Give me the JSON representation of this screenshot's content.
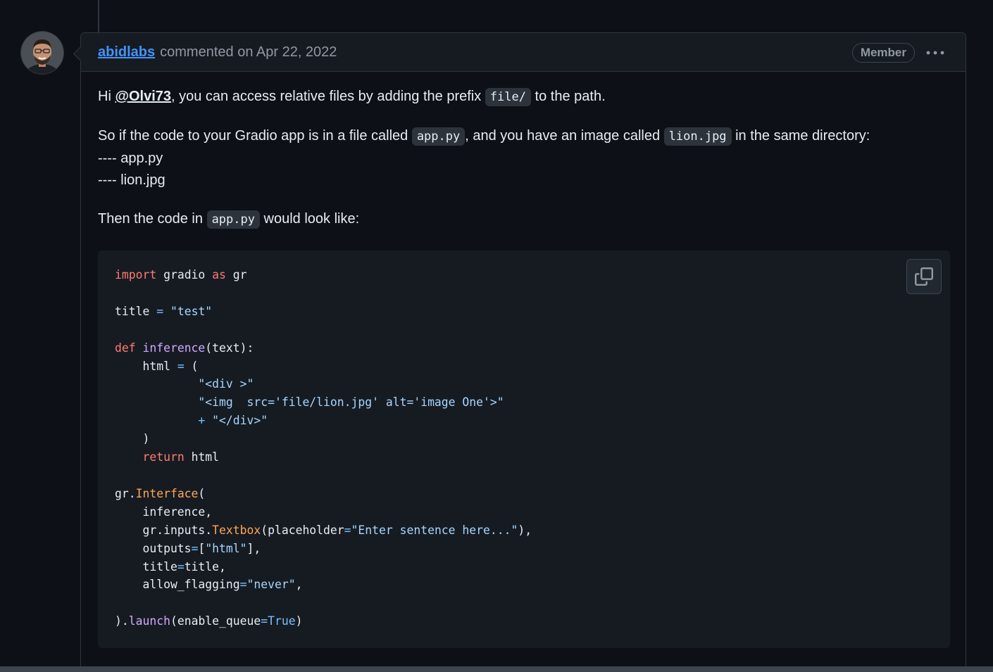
{
  "comment": {
    "author": "abidlabs",
    "action_text": "commented on Apr 22, 2022",
    "badge": "Member",
    "menu_icon": "kebab-horizontal-icon",
    "paragraph1": {
      "prefix": "Hi ",
      "mention": "@Olvi73",
      "middle": ", you can access relative files by adding the prefix ",
      "code": "file/",
      "suffix": " to the path."
    },
    "paragraph2": {
      "prefix": "So if the code to your Gradio app is in a file called ",
      "code1": "app.py",
      "middle": ", and you have an image called ",
      "code2": "lion.jpg",
      "suffix": " in the same directory:",
      "line1": "---- app.py",
      "line2": "---- lion.jpg"
    },
    "paragraph3": {
      "prefix": "Then the code in ",
      "code": "app.py",
      "suffix": " would look like:"
    },
    "code_block": {
      "copy_icon": "copy-icon",
      "lines": [
        [
          [
            "kw",
            "import"
          ],
          [
            "t",
            " gradio "
          ],
          [
            "kw",
            "as"
          ],
          [
            "t",
            " gr"
          ]
        ],
        [],
        [
          [
            "t",
            "title "
          ],
          [
            "op",
            "="
          ],
          [
            "t",
            " "
          ],
          [
            "str",
            "\"test\""
          ]
        ],
        [],
        [
          [
            "kw",
            "def"
          ],
          [
            "t",
            " "
          ],
          [
            "fn",
            "inference"
          ],
          [
            "t",
            "(text):"
          ]
        ],
        [
          [
            "t",
            "    html "
          ],
          [
            "op",
            "="
          ],
          [
            "t",
            " ("
          ]
        ],
        [
          [
            "t",
            "            "
          ],
          [
            "str",
            "\"<div >\""
          ]
        ],
        [
          [
            "t",
            "            "
          ],
          [
            "str",
            "\"<img  src='file/lion.jpg' alt='image One'>\""
          ]
        ],
        [
          [
            "t",
            "            "
          ],
          [
            "op",
            "+"
          ],
          [
            "t",
            " "
          ],
          [
            "str",
            "\"</div>\""
          ]
        ],
        [
          [
            "t",
            "    )"
          ]
        ],
        [
          [
            "t",
            "    "
          ],
          [
            "kw",
            "return"
          ],
          [
            "t",
            " html"
          ]
        ],
        [],
        [
          [
            "t",
            "gr."
          ],
          [
            "cls",
            "Interface"
          ],
          [
            "t",
            "("
          ]
        ],
        [
          [
            "t",
            "    inference,"
          ]
        ],
        [
          [
            "t",
            "    gr.inputs."
          ],
          [
            "cls",
            "Textbox"
          ],
          [
            "t",
            "(placeholder"
          ],
          [
            "op",
            "="
          ],
          [
            "str",
            "\"Enter sentence here...\""
          ],
          [
            "t",
            "),"
          ]
        ],
        [
          [
            "t",
            "    outputs"
          ],
          [
            "op",
            "="
          ],
          [
            "t",
            "["
          ],
          [
            "str",
            "\"html\""
          ],
          [
            "t",
            "],"
          ]
        ],
        [
          [
            "t",
            "    title"
          ],
          [
            "op",
            "="
          ],
          [
            "t",
            "title,"
          ]
        ],
        [
          [
            "t",
            "    allow_flagging"
          ],
          [
            "op",
            "="
          ],
          [
            "str",
            "\"never\""
          ],
          [
            "t",
            ","
          ]
        ],
        [],
        [
          [
            "t",
            ")."
          ],
          [
            "fn",
            "launch"
          ],
          [
            "t",
            "(enable_queue"
          ],
          [
            "op",
            "="
          ],
          [
            "op",
            "True"
          ],
          [
            "t",
            ")"
          ]
        ]
      ]
    }
  }
}
